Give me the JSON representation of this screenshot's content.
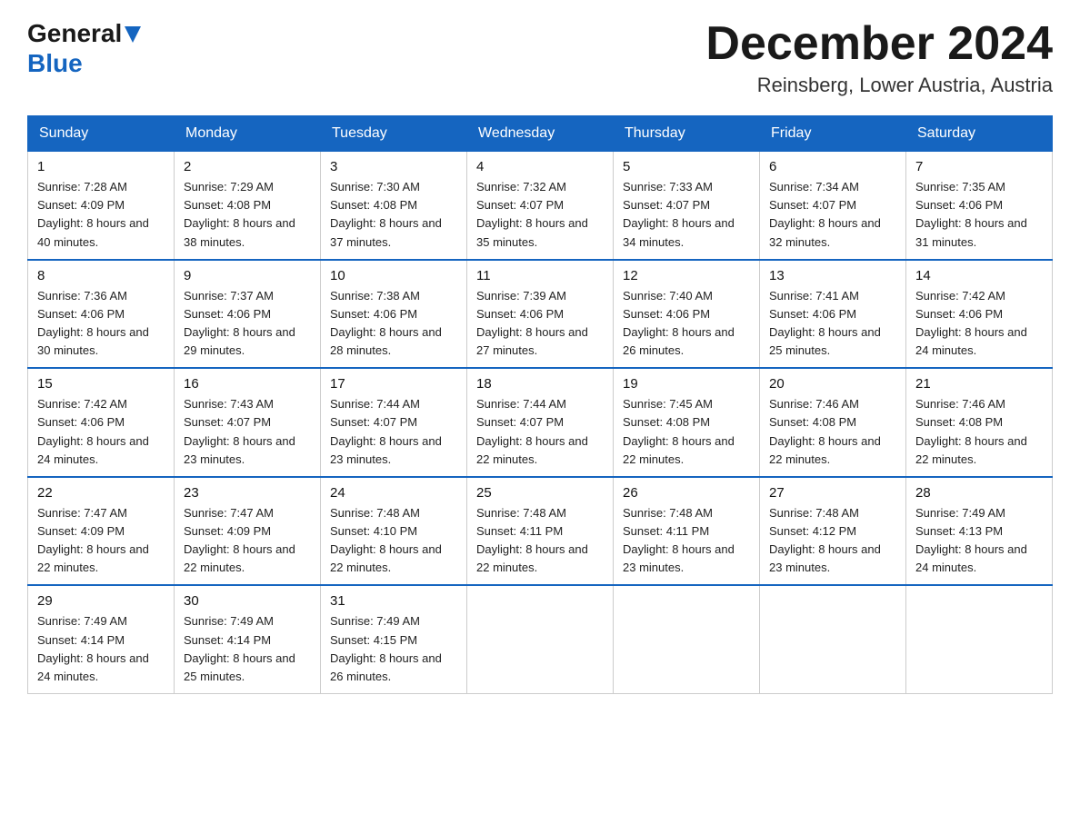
{
  "header": {
    "logo_general": "General",
    "logo_blue": "Blue",
    "month_title": "December 2024",
    "location": "Reinsberg, Lower Austria, Austria"
  },
  "days_of_week": [
    "Sunday",
    "Monday",
    "Tuesday",
    "Wednesday",
    "Thursday",
    "Friday",
    "Saturday"
  ],
  "weeks": [
    [
      {
        "num": "1",
        "sunrise": "7:28 AM",
        "sunset": "4:09 PM",
        "daylight": "8 hours and 40 minutes."
      },
      {
        "num": "2",
        "sunrise": "7:29 AM",
        "sunset": "4:08 PM",
        "daylight": "8 hours and 38 minutes."
      },
      {
        "num": "3",
        "sunrise": "7:30 AM",
        "sunset": "4:08 PM",
        "daylight": "8 hours and 37 minutes."
      },
      {
        "num": "4",
        "sunrise": "7:32 AM",
        "sunset": "4:07 PM",
        "daylight": "8 hours and 35 minutes."
      },
      {
        "num": "5",
        "sunrise": "7:33 AM",
        "sunset": "4:07 PM",
        "daylight": "8 hours and 34 minutes."
      },
      {
        "num": "6",
        "sunrise": "7:34 AM",
        "sunset": "4:07 PM",
        "daylight": "8 hours and 32 minutes."
      },
      {
        "num": "7",
        "sunrise": "7:35 AM",
        "sunset": "4:06 PM",
        "daylight": "8 hours and 31 minutes."
      }
    ],
    [
      {
        "num": "8",
        "sunrise": "7:36 AM",
        "sunset": "4:06 PM",
        "daylight": "8 hours and 30 minutes."
      },
      {
        "num": "9",
        "sunrise": "7:37 AM",
        "sunset": "4:06 PM",
        "daylight": "8 hours and 29 minutes."
      },
      {
        "num": "10",
        "sunrise": "7:38 AM",
        "sunset": "4:06 PM",
        "daylight": "8 hours and 28 minutes."
      },
      {
        "num": "11",
        "sunrise": "7:39 AM",
        "sunset": "4:06 PM",
        "daylight": "8 hours and 27 minutes."
      },
      {
        "num": "12",
        "sunrise": "7:40 AM",
        "sunset": "4:06 PM",
        "daylight": "8 hours and 26 minutes."
      },
      {
        "num": "13",
        "sunrise": "7:41 AM",
        "sunset": "4:06 PM",
        "daylight": "8 hours and 25 minutes."
      },
      {
        "num": "14",
        "sunrise": "7:42 AM",
        "sunset": "4:06 PM",
        "daylight": "8 hours and 24 minutes."
      }
    ],
    [
      {
        "num": "15",
        "sunrise": "7:42 AM",
        "sunset": "4:06 PM",
        "daylight": "8 hours and 24 minutes."
      },
      {
        "num": "16",
        "sunrise": "7:43 AM",
        "sunset": "4:07 PM",
        "daylight": "8 hours and 23 minutes."
      },
      {
        "num": "17",
        "sunrise": "7:44 AM",
        "sunset": "4:07 PM",
        "daylight": "8 hours and 23 minutes."
      },
      {
        "num": "18",
        "sunrise": "7:44 AM",
        "sunset": "4:07 PM",
        "daylight": "8 hours and 22 minutes."
      },
      {
        "num": "19",
        "sunrise": "7:45 AM",
        "sunset": "4:08 PM",
        "daylight": "8 hours and 22 minutes."
      },
      {
        "num": "20",
        "sunrise": "7:46 AM",
        "sunset": "4:08 PM",
        "daylight": "8 hours and 22 minutes."
      },
      {
        "num": "21",
        "sunrise": "7:46 AM",
        "sunset": "4:08 PM",
        "daylight": "8 hours and 22 minutes."
      }
    ],
    [
      {
        "num": "22",
        "sunrise": "7:47 AM",
        "sunset": "4:09 PM",
        "daylight": "8 hours and 22 minutes."
      },
      {
        "num": "23",
        "sunrise": "7:47 AM",
        "sunset": "4:09 PM",
        "daylight": "8 hours and 22 minutes."
      },
      {
        "num": "24",
        "sunrise": "7:48 AM",
        "sunset": "4:10 PM",
        "daylight": "8 hours and 22 minutes."
      },
      {
        "num": "25",
        "sunrise": "7:48 AM",
        "sunset": "4:11 PM",
        "daylight": "8 hours and 22 minutes."
      },
      {
        "num": "26",
        "sunrise": "7:48 AM",
        "sunset": "4:11 PM",
        "daylight": "8 hours and 23 minutes."
      },
      {
        "num": "27",
        "sunrise": "7:48 AM",
        "sunset": "4:12 PM",
        "daylight": "8 hours and 23 minutes."
      },
      {
        "num": "28",
        "sunrise": "7:49 AM",
        "sunset": "4:13 PM",
        "daylight": "8 hours and 24 minutes."
      }
    ],
    [
      {
        "num": "29",
        "sunrise": "7:49 AM",
        "sunset": "4:14 PM",
        "daylight": "8 hours and 24 minutes."
      },
      {
        "num": "30",
        "sunrise": "7:49 AM",
        "sunset": "4:14 PM",
        "daylight": "8 hours and 25 minutes."
      },
      {
        "num": "31",
        "sunrise": "7:49 AM",
        "sunset": "4:15 PM",
        "daylight": "8 hours and 26 minutes."
      },
      null,
      null,
      null,
      null
    ]
  ],
  "labels": {
    "sunrise_prefix": "Sunrise: ",
    "sunset_prefix": "Sunset: ",
    "daylight_prefix": "Daylight: "
  }
}
